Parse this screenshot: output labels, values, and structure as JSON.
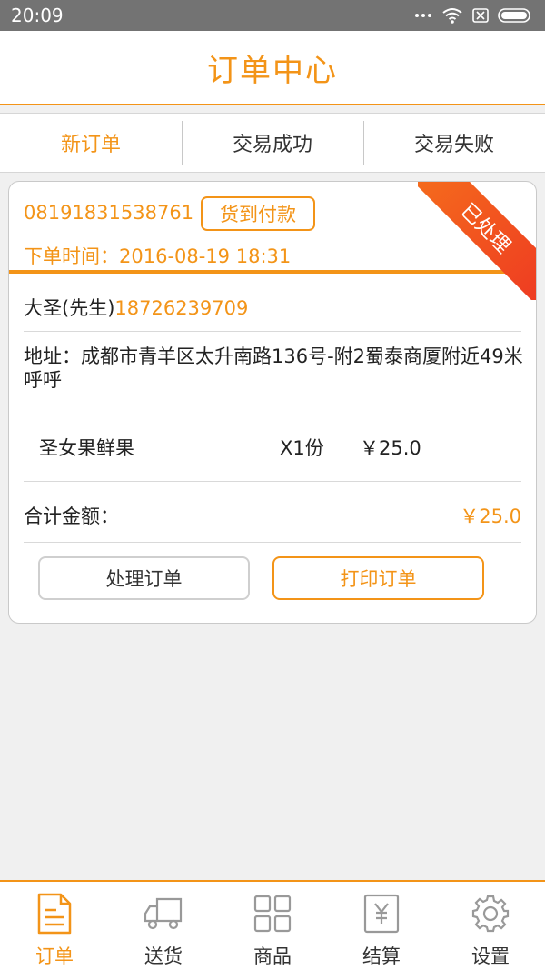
{
  "status_bar": {
    "time": "20:09"
  },
  "header": {
    "title": "订单中心"
  },
  "tabs": [
    {
      "label": "新订单",
      "active": true
    },
    {
      "label": "交易成功",
      "active": false
    },
    {
      "label": "交易失败",
      "active": false
    }
  ],
  "order": {
    "order_no": "08191831538761",
    "payment_type": "货到付款",
    "order_time": "下单时间：2016-08-19 18:31",
    "status_ribbon": "已处理",
    "customer_name": "大圣(先生)",
    "customer_phone": "18726239709",
    "address": "地址：成都市青羊区太升南路136号-附2蜀泰商厦附近49米 呼呼",
    "items": [
      {
        "name": "圣女果鲜果",
        "qty": "X1份",
        "price": "￥25.0"
      }
    ],
    "total_label": "合计金额：",
    "total_value": "￥25.0",
    "process_button": "处理订单",
    "print_button": "打印订单"
  },
  "bottom_nav": [
    {
      "label": "订单",
      "icon": "order-doc-icon",
      "active": true
    },
    {
      "label": "送货",
      "icon": "delivery-truck-icon",
      "active": false
    },
    {
      "label": "商品",
      "icon": "grid-goods-icon",
      "active": false
    },
    {
      "label": "结算",
      "icon": "yen-settle-icon",
      "active": false
    },
    {
      "label": "设置",
      "icon": "gear-icon",
      "active": false
    }
  ],
  "colors": {
    "accent": "#f39418",
    "ribbon": "#ee3b22",
    "statusbar": "#737373"
  }
}
